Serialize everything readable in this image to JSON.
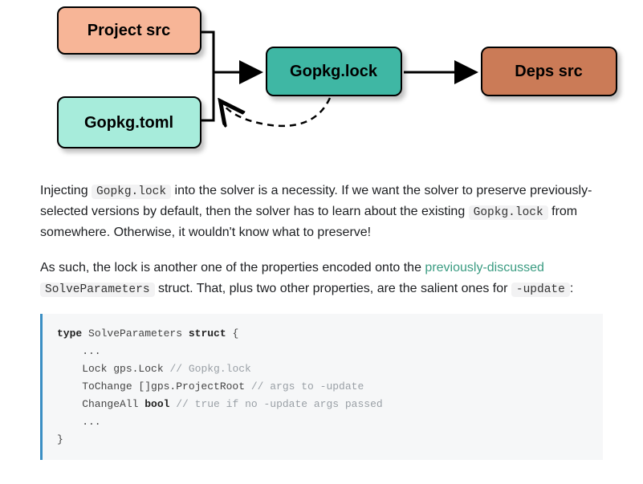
{
  "diagram": {
    "project_src": "Project src",
    "gopkg_toml": "Gopkg.toml",
    "gopkg_lock": "Gopkg.lock",
    "deps_src": "Deps src"
  },
  "para1": {
    "t1": "Injecting ",
    "c1": "Gopkg.lock",
    "t2": " into the solver is a necessity. If we want the solver to preserve previously-selected versions by default, then the solver has to learn about the existing ",
    "c2": "Gopkg.lock",
    "t3": " from somewhere. Otherwise, it wouldn't know what to preserve!"
  },
  "para2": {
    "t1": "As such, the lock is another one of the properties encoded onto the ",
    "link": "previously-discussed",
    "t2": " ",
    "c1": "SolveParameters",
    "t3": " struct. That, plus two other properties, are the salient ones for ",
    "c2": "-update",
    "t4": ":"
  },
  "code": {
    "kw_type": "type",
    "name": " SolveParameters ",
    "kw_struct": "struct",
    "open": " {",
    "dots1": "    ...",
    "l_lock": "    Lock gps.Lock ",
    "l_lock_cm": "// Gopkg.lock",
    "l_tc": "    ToChange []gps.ProjectRoot ",
    "l_tc_cm": "// args to -update",
    "l_ca1": "    ChangeAll ",
    "kw_bool": "bool",
    "l_ca_sp": " ",
    "l_ca_cm": "// true if no -update args passed",
    "dots2": "    ...",
    "close": "}"
  }
}
